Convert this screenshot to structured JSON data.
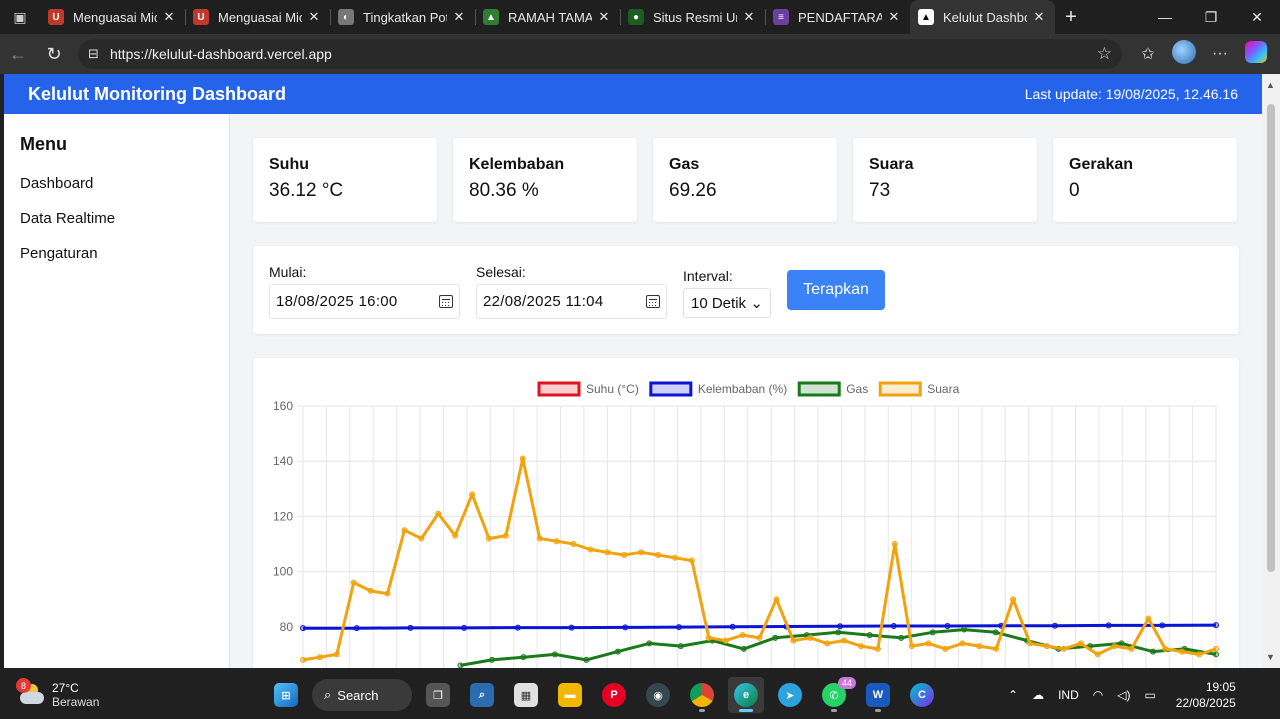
{
  "browser": {
    "tabs": [
      {
        "title": "Menguasai Mic",
        "fav_color": "#c0392b",
        "fav_text": "U"
      },
      {
        "title": "Menguasai Mic",
        "fav_color": "#c0392b",
        "fav_text": "U"
      },
      {
        "title": "Tingkatkan Pote",
        "fav_color": "#777777",
        "fav_text": "◐"
      },
      {
        "title": "RAMAH TAMAH",
        "fav_color": "#2e7d32",
        "fav_text": "▲"
      },
      {
        "title": "Situs Resmi Uni",
        "fav_color": "#1b5e20",
        "fav_text": "●"
      },
      {
        "title": "PENDAFTARAN",
        "fav_color": "#6a3fa0",
        "fav_text": "≡"
      },
      {
        "title": "Kelulut Dashbo",
        "fav_color": "#ffffff",
        "fav_text": "▲",
        "active": true
      }
    ],
    "url": "https://kelulut-dashboard.vercel.app"
  },
  "header": {
    "title": "Kelulut Monitoring Dashboard",
    "last_update": "Last update: 19/08/2025, 12.46.16"
  },
  "sidebar": {
    "title": "Menu",
    "items": [
      "Dashboard",
      "Data Realtime",
      "Pengaturan"
    ]
  },
  "cards": [
    {
      "label": "Suhu",
      "value": "36.12 °C"
    },
    {
      "label": "Kelembaban",
      "value": "80.36 %"
    },
    {
      "label": "Gas",
      "value": "69.26"
    },
    {
      "label": "Suara",
      "value": "73"
    },
    {
      "label": "Gerakan",
      "value": "0"
    }
  ],
  "filter": {
    "start_label": "Mulai:",
    "start_value": "18/08/2025  16:00",
    "end_label": "Selesai:",
    "end_value": "22/08/2025  11:04",
    "interval_label": "Interval:",
    "interval_value": "10 Detik",
    "apply_label": "Terapkan"
  },
  "chart_data": {
    "type": "line",
    "series": [
      {
        "name": "Suhu (°C)",
        "color": "#e0141e",
        "values": []
      },
      {
        "name": "Kelembaban (%)",
        "color": "#0b14d4",
        "values": [
          79.5,
          79.5,
          79.6,
          79.6,
          79.7,
          79.7,
          79.8,
          79.9,
          80.0,
          80.1,
          80.2,
          80.3,
          80.3,
          80.4,
          80.4,
          80.5,
          80.5,
          80.6
        ]
      },
      {
        "name": "Gas",
        "color": "#1a7a1a",
        "values": [
          null,
          null,
          null,
          null,
          null,
          66,
          68,
          69,
          70,
          68,
          71,
          74,
          73,
          75,
          72,
          76,
          77,
          78,
          77,
          76,
          78,
          79,
          78,
          75,
          72,
          73,
          74,
          71,
          72,
          70
        ]
      },
      {
        "name": "Suara",
        "color": "#f2a20c",
        "values": [
          68,
          69,
          70,
          96,
          93,
          92,
          115,
          112,
          121,
          113,
          128,
          112,
          113,
          141,
          112,
          111,
          110,
          108,
          107,
          106,
          107,
          106,
          105,
          104,
          76,
          75,
          77,
          76,
          90,
          75,
          76,
          74,
          75,
          73,
          72,
          110,
          73,
          74,
          72,
          74,
          73,
          72,
          90,
          74,
          73,
          72,
          74,
          70,
          73,
          72,
          83,
          72,
          71,
          70,
          72
        ]
      }
    ],
    "ylim": [
      60,
      160
    ],
    "yticks": [
      "160",
      "140",
      "120",
      "100",
      "80"
    ],
    "grid": true,
    "legend_position": "top-center"
  },
  "taskbar": {
    "weather_temp": "27°C",
    "weather_desc": "Berawan",
    "weather_badge": "8",
    "search_label": "Search",
    "whatsapp_badge": "44",
    "lang": "IND",
    "time": "19:05",
    "date": "22/08/2025"
  }
}
